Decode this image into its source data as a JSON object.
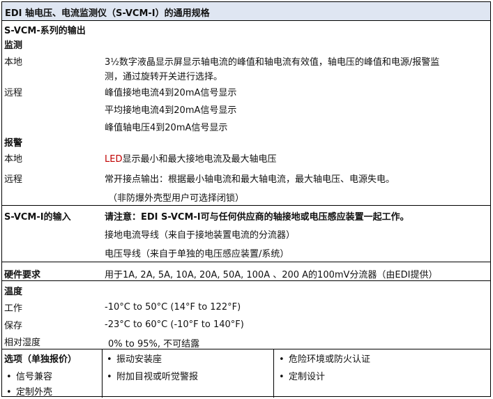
{
  "title": "EDI 轴电压、电流监测仪（S-VCM-I）的通用规格",
  "outputs": {
    "heading": "S-VCM-系列的输出",
    "monitor_heading": "监测",
    "local_label": "本地",
    "local_text_1": "3½数字液晶显示屏显示轴电流的峰值和轴电流有效值，轴电压的峰值和电源/报警监",
    "local_text_2": "测，通过旋转开关进行选择。",
    "remote_label": "远程",
    "remote_lines": [
      "峰值接地电流4到20mA信号显示",
      "平均接地电流4到20mA信号显示",
      "峰值轴电压4到20mA信号显示"
    ],
    "alarm_heading": "报警",
    "alarm_local_label": "本地",
    "alarm_local_led": "LED",
    "alarm_local_rest": "显示最小和最大接地电流及最大轴电压",
    "alarm_remote_label": "远程",
    "alarm_remote_text": "常开接点输出：根据最小轴电流和最大轴电流，最大轴电压、电源失电。",
    "alarm_remote_note": "（非防爆外壳型用户可选择闭锁）"
  },
  "inputs": {
    "heading": "S-VCM-I的输入",
    "note": "请注意：EDI S-VCM-I可与任何供应商的轴接地或电压感应装置一起工作。",
    "line_1": "接地电流导线（来自于接地装置电流的分流器）",
    "line_2": "电压导线（来自于单独的电压感应装置/系统）"
  },
  "hardware": {
    "heading": "硬件要求",
    "text": "用于1A, 2A, 5A, 10A, 20A, 50A, 100A 、200 A的100mV分流器（由EDI提供）"
  },
  "temperature": {
    "heading": "温度",
    "operating_label": "工作",
    "operating_value": "-10°C to 50°C (14°F to 122°F)",
    "storage_label": "保存",
    "storage_value": "-23°C to 60°C (-10°F to 140°F)",
    "humidity_label": "相对湿度",
    "humidity_value": "0% to 95%, 不可结露"
  },
  "options": {
    "heading": "选项（单独报价）",
    "bullet": "•",
    "col1": [
      "信号兼容",
      "定制外壳"
    ],
    "col2": [
      "振动安装座",
      "附加目视或听觉警报"
    ],
    "col3": [
      "危险环境或防火认证",
      "定制设计"
    ]
  },
  "colors": {
    "title_bg": "#dfe6f2",
    "led_color": "#c00000"
  }
}
